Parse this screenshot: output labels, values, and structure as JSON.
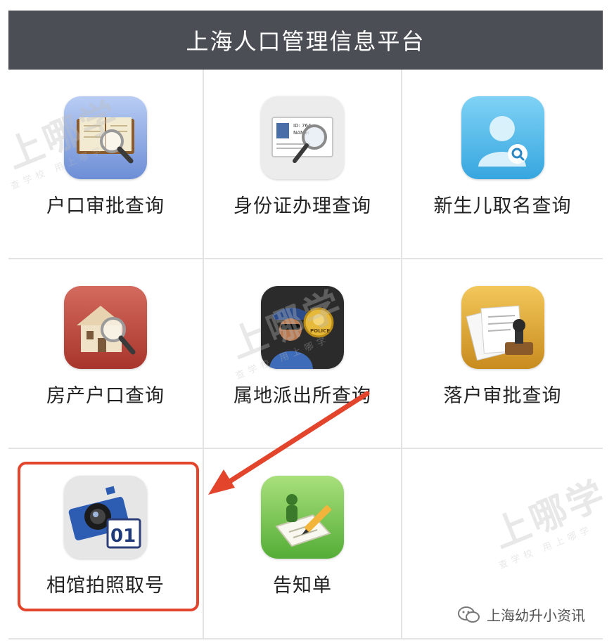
{
  "header": {
    "title": "上海人口管理信息平台"
  },
  "grid": {
    "items": [
      {
        "label": "户口审批查询"
      },
      {
        "label": "身份证办理查询"
      },
      {
        "label": "新生儿取名查询"
      },
      {
        "label": "房产户口查询"
      },
      {
        "label": "属地派出所查询"
      },
      {
        "label": "落户审批查询"
      },
      {
        "label": "相馆拍照取号"
      },
      {
        "label": "告知单"
      }
    ]
  },
  "icons": {
    "item_0": "book-search-icon",
    "item_1": "id-card-search-icon",
    "item_2": "person-search-icon",
    "item_3": "house-search-icon",
    "item_4": "police-officer-icon",
    "item_5": "documents-stamp-icon",
    "item_6": "camera-number-icon",
    "item_7": "notice-pencil-icon"
  },
  "icon_text": {
    "card_id": "ID: 764",
    "card_name": "NAME:",
    "badge": "POLICE",
    "number": "01"
  },
  "watermark": {
    "brand": "上哪学",
    "sub": "查学校 用上哪学"
  },
  "footer": {
    "account": "上海幼升小资讯"
  },
  "colors": {
    "header_bg": "#4b4f55",
    "highlight": "#e2452c",
    "arrow": "#e2452c"
  }
}
